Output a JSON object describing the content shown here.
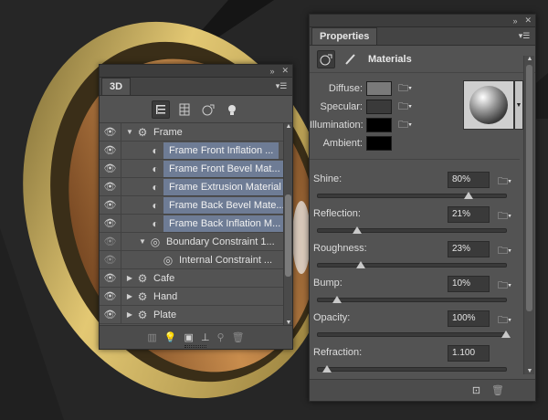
{
  "panel_3d": {
    "tab_label": "3D",
    "toolbar_icons": [
      "scene-filter-icon",
      "mesh-filter-icon",
      "material-filter-icon",
      "light-filter-icon"
    ],
    "layers": [
      {
        "name": "Frame",
        "visible": true,
        "twist": "open",
        "indent": 0,
        "icon": "mesh-icon",
        "selected": false
      },
      {
        "name": "Frame Front Inflation ...",
        "visible": true,
        "twist": "none",
        "indent": 1,
        "icon": "material-icon",
        "selected": true
      },
      {
        "name": "Frame Front Bevel Mat...",
        "visible": true,
        "twist": "none",
        "indent": 1,
        "icon": "material-icon",
        "selected": true
      },
      {
        "name": "Frame Extrusion Material",
        "visible": true,
        "twist": "none",
        "indent": 1,
        "icon": "material-icon",
        "selected": true
      },
      {
        "name": "Frame Back Bevel Mate...",
        "visible": true,
        "twist": "none",
        "indent": 1,
        "icon": "material-icon",
        "selected": true
      },
      {
        "name": "Frame Back Inflation M...",
        "visible": true,
        "twist": "none",
        "indent": 1,
        "icon": "material-icon",
        "selected": true
      },
      {
        "name": "Boundary Constraint 1...",
        "visible": false,
        "twist": "open",
        "indent": 1,
        "icon": "constraint-icon",
        "selected": false
      },
      {
        "name": "Internal Constraint ...",
        "visible": false,
        "twist": "none",
        "indent": 2,
        "icon": "constraint-icon",
        "selected": false
      },
      {
        "name": "Cafe",
        "visible": true,
        "twist": "closed",
        "indent": 0,
        "icon": "mesh-icon",
        "selected": false
      },
      {
        "name": "Hand",
        "visible": true,
        "twist": "closed",
        "indent": 0,
        "icon": "mesh-icon",
        "selected": false
      },
      {
        "name": "Plate",
        "visible": true,
        "twist": "closed",
        "indent": 0,
        "icon": "mesh-icon",
        "selected": false
      }
    ],
    "scroll_position": 0.85
  },
  "properties": {
    "tab_label": "Properties",
    "section_title": "Materials",
    "swatches": [
      {
        "label": "Diffuse:",
        "color": "#7a7a7a",
        "key": "diffuse"
      },
      {
        "label": "Specular:",
        "color": "#3a3a3a",
        "key": "specular"
      },
      {
        "label": "Illumination:",
        "color": "#000000",
        "key": "illumination"
      },
      {
        "label": "Ambient:",
        "color": "#000000",
        "key": "ambient"
      }
    ],
    "props": [
      {
        "label": "Shine:",
        "value": "80%",
        "fraction": 0.8,
        "key": "shine"
      },
      {
        "label": "Reflection:",
        "value": "21%",
        "fraction": 0.21,
        "key": "reflection"
      },
      {
        "label": "Roughness:",
        "value": "23%",
        "fraction": 0.23,
        "key": "roughness"
      },
      {
        "label": "Bump:",
        "value": "10%",
        "fraction": 0.1,
        "key": "bump"
      },
      {
        "label": "Opacity:",
        "value": "100%",
        "fraction": 1.0,
        "key": "opacity"
      },
      {
        "label": "Refraction:",
        "value": "1.100",
        "fraction": 0.05,
        "key": "refraction"
      }
    ]
  },
  "colors": {
    "panel_bg": "#535353",
    "selection": "#6e7c95",
    "wood": "#b77a3c",
    "gold": "#d9b860"
  }
}
